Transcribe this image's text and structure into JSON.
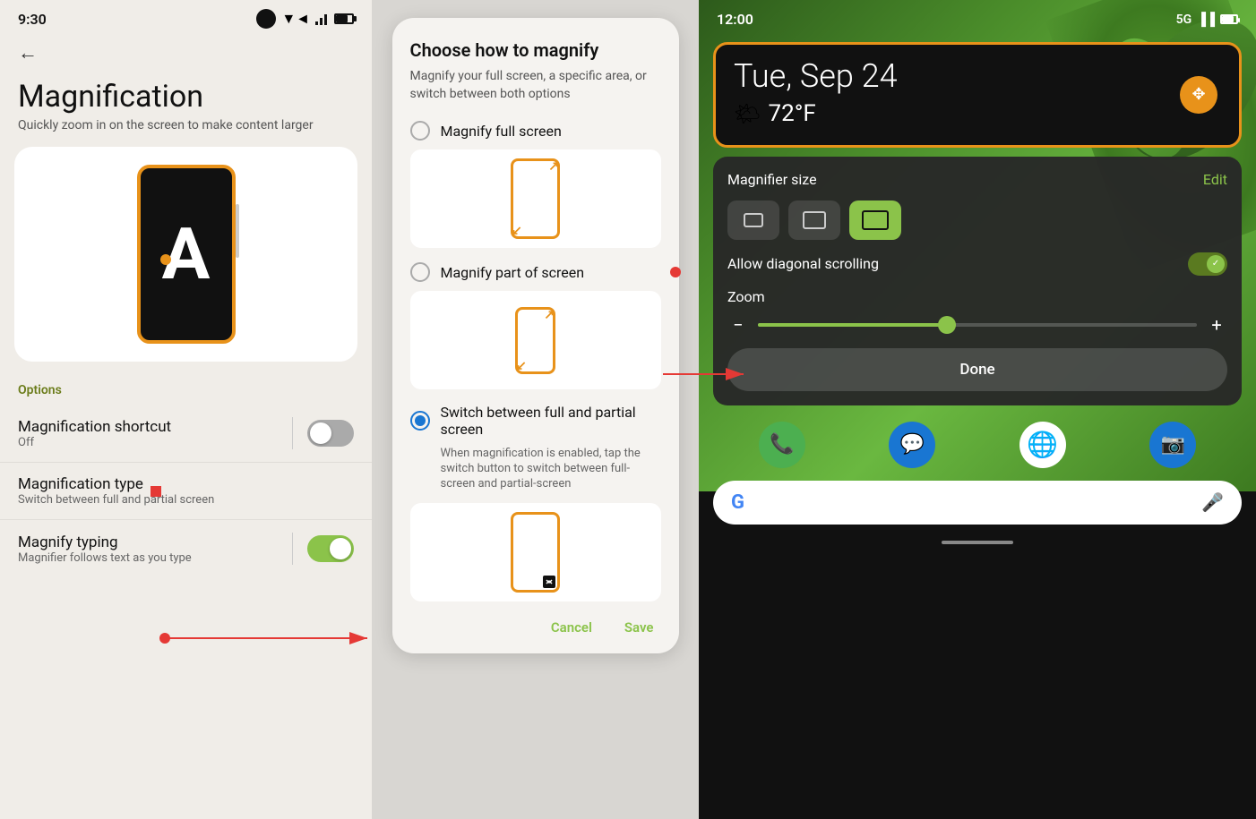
{
  "leftPanel": {
    "statusTime": "9:30",
    "pageTitle": "Magnification",
    "pageSubtitle": "Quickly zoom in on the screen to make content larger",
    "optionsLabel": "Options",
    "settings": [
      {
        "name": "Magnification shortcut",
        "value": "Off",
        "hasToggle": true,
        "toggleState": "off"
      },
      {
        "name": "Magnification type",
        "value": "Switch between full and partial screen",
        "hasToggle": false
      },
      {
        "name": "Magnify typing",
        "value": "Magnifier follows text as you type",
        "hasToggle": true,
        "toggleState": "on"
      }
    ]
  },
  "middlePanel": {
    "dialogTitle": "Choose how to magnify",
    "dialogDesc": "Magnify your full screen, a specific area, or switch between both options",
    "options": [
      {
        "label": "Magnify full screen",
        "selected": false
      },
      {
        "label": "Magnify part of screen",
        "selected": false
      },
      {
        "label": "Switch between full and partial screen",
        "selected": true,
        "desc": "When magnification is enabled, tap the switch button to switch between full-screen and partial-screen"
      }
    ],
    "cancelLabel": "Cancel",
    "saveLabel": "Save"
  },
  "rightPanel": {
    "statusTime": "12:00",
    "statusNetwork": "5G",
    "clockDate": "Tue, Sep 24",
    "weatherIcon": "🌤",
    "weatherTemp": "72°F",
    "magnifierSize": "Magnifier size",
    "editLabel": "Edit",
    "sizes": [
      "sm",
      "md",
      "lg"
    ],
    "activeSize": "lg",
    "diagLabel": "Allow diagonal scrolling",
    "zoomLabel": "Zoom",
    "doneLabel": "Done",
    "apps": [
      "📞",
      "💬",
      "🌐",
      "📷"
    ]
  }
}
